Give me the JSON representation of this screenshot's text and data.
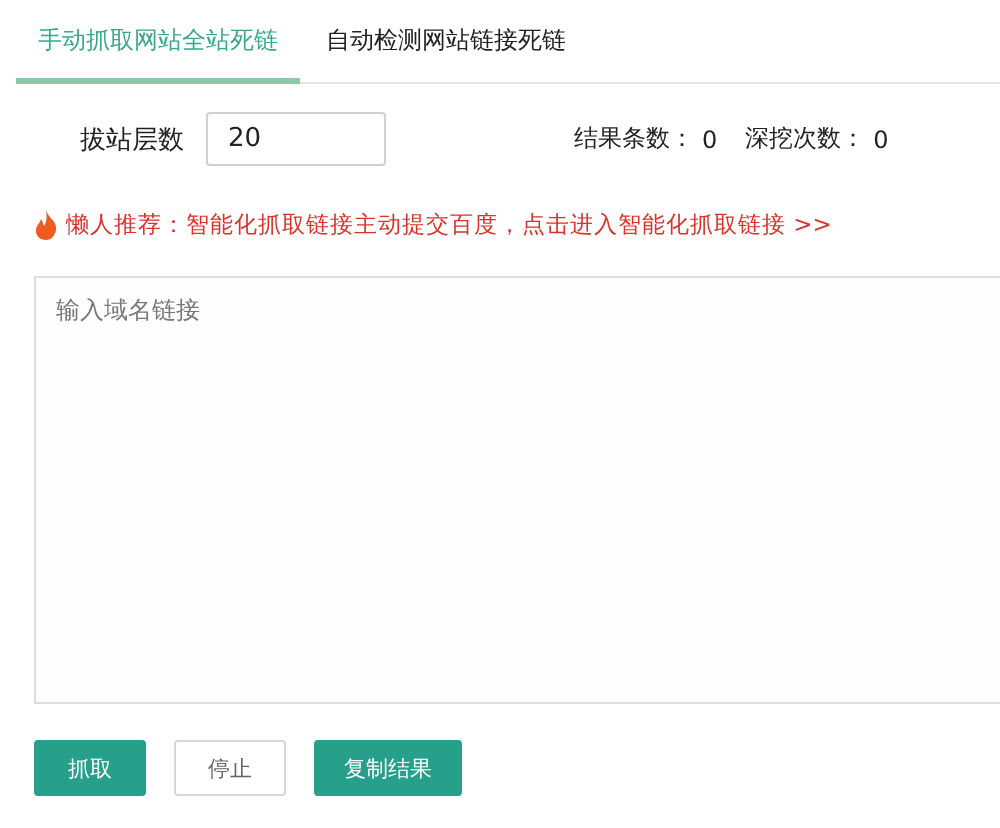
{
  "tabs": [
    {
      "label": "手动抓取网站全站死链",
      "selected": true
    },
    {
      "label": "自动检测网站链接死链",
      "selected": false
    }
  ],
  "depth": {
    "label": "拔站层数",
    "value": "20"
  },
  "stats": [
    {
      "label": "结果条数：",
      "value": "0"
    },
    {
      "label": "深挖次数：",
      "value": "0"
    }
  ],
  "tip": "懒人推荐：智能化抓取链接主动提交百度，点击进入智能化抓取链接 >>",
  "url_input": {
    "placeholder": "输入域名链接"
  },
  "buttons": [
    {
      "label": "抓取",
      "kind": "primary"
    },
    {
      "label": "停止",
      "kind": "default"
    },
    {
      "label": "复制结果",
      "kind": "primary"
    }
  ]
}
